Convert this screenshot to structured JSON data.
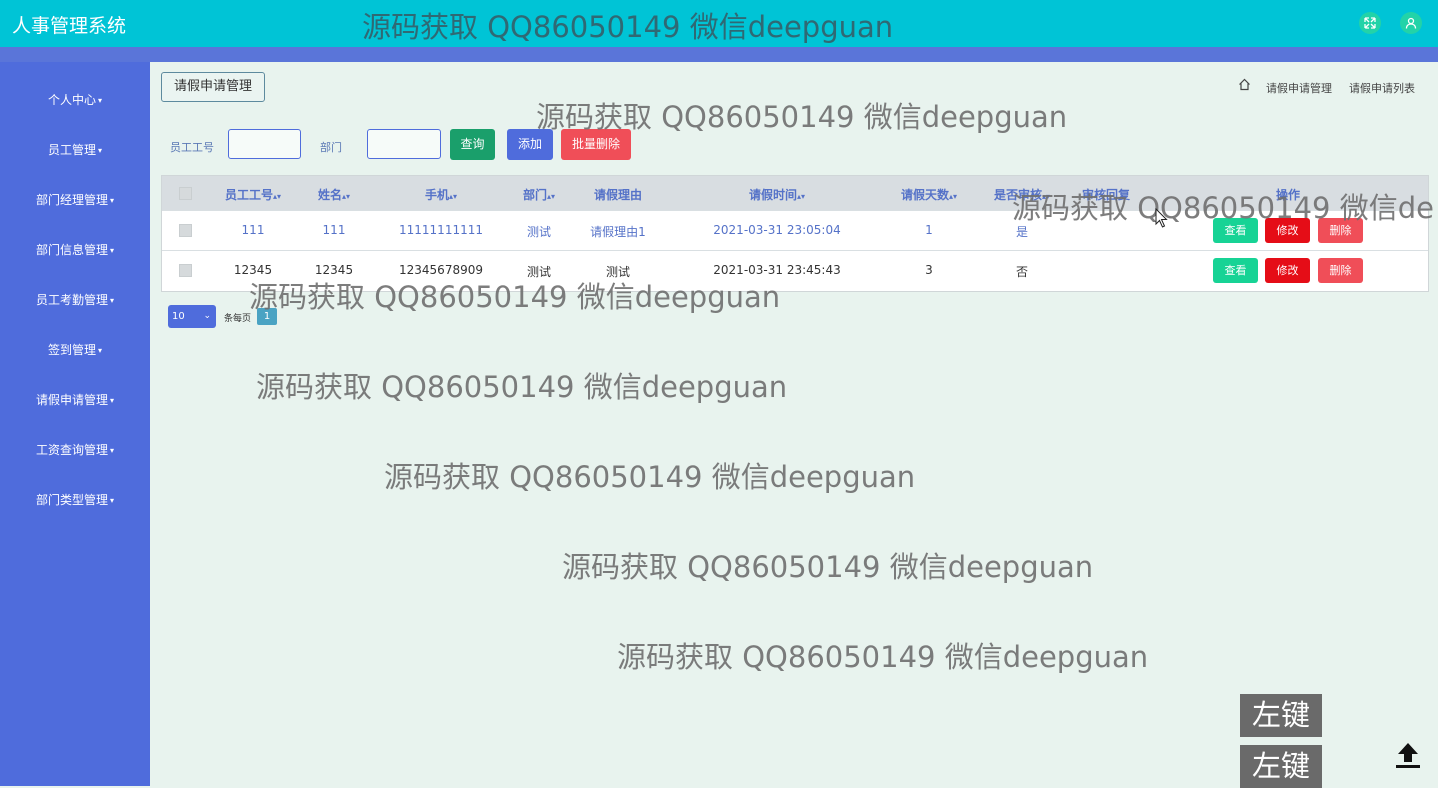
{
  "app_title": "人事管理系统",
  "sidebar": {
    "items": [
      {
        "label": "个人中心"
      },
      {
        "label": "员工管理"
      },
      {
        "label": "部门经理管理"
      },
      {
        "label": "部门信息管理"
      },
      {
        "label": "员工考勤管理"
      },
      {
        "label": "签到管理"
      },
      {
        "label": "请假申请管理"
      },
      {
        "label": "工资查询管理"
      },
      {
        "label": "部门类型管理"
      }
    ]
  },
  "page": {
    "title_button": "请假申请管理",
    "breadcrumb": [
      "请假申请管理",
      "请假申请列表"
    ]
  },
  "search": {
    "emp_no_label": "员工工号",
    "dept_label": "部门",
    "query_btn": "查询",
    "add_btn": "添加",
    "batch_delete_btn": "批量删除"
  },
  "table": {
    "headers": [
      "员工工号",
      "姓名",
      "手机",
      "部门",
      "请假理由",
      "请假时间",
      "请假天数",
      "是否审核",
      "审核回复",
      "操作"
    ],
    "rows": [
      {
        "emp_no": "111",
        "name": "111",
        "phone": "11111111111",
        "dept": "测试",
        "reason": "请假理由1",
        "time": "2021-03-31 23:05:04",
        "days": "1",
        "audited": "是",
        "reply": ""
      },
      {
        "emp_no": "12345",
        "name": "12345",
        "phone": "12345678909",
        "dept": "测试",
        "reason": "测试",
        "time": "2021-03-31 23:45:43",
        "days": "3",
        "audited": "否",
        "reply": ""
      }
    ],
    "actions": {
      "view": "查看",
      "edit": "修改",
      "delete": "删除"
    }
  },
  "pager": {
    "page_size": "10",
    "per_page_label": "条每页",
    "current_page": "1"
  },
  "watermarks": [
    "源码获取 QQ86050149 微信deepguan",
    "源码获取 QQ86050149 微信deepguan",
    "源码获取 QQ86050149 微信deepguan",
    "源码获取 QQ86050149 微信deepguan",
    "源码获取 QQ86050149 微信deepguan",
    "源码获取 QQ86050149 微信deepguan",
    "源码获取 QQ86050149 微信deepguan",
    "源码获取 QQ86050149 微信de"
  ],
  "key_tips": [
    "左键",
    "左键"
  ],
  "colors": {
    "topbar": "#00c4d6",
    "sidebar": "#4f6cdc",
    "content_bg": "#e8f3ee",
    "query_btn": "#1a9f6b",
    "add_btn": "#4f6cdc",
    "delete_btn": "#f04e58",
    "view_btn": "#17d395",
    "edit_btn": "#e50d17",
    "link_text": "#5572c8"
  }
}
